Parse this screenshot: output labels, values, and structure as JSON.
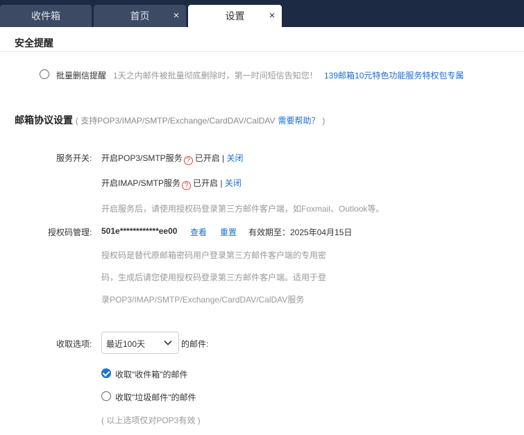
{
  "tabs": [
    {
      "label": "收件箱",
      "closable": false,
      "active": false
    },
    {
      "label": "首页",
      "closable": true,
      "active": false,
      "close": "×"
    },
    {
      "label": "设置",
      "closable": true,
      "active": true,
      "close": "×"
    }
  ],
  "security": {
    "title": "安全提醒",
    "option_label": "批量删信提醒",
    "option_desc": "1天之内邮件被批量彻底删除时，第一时间短信告知您！",
    "promo_link": "139邮箱10元特色功能服务特权包专属"
  },
  "protocol": {
    "title": "邮箱协议设置",
    "subtitle_prefix": "( 支持POP3/IMAP/SMTP/Exchange/CardDAV/CalDAV",
    "help_link": "需要帮助？",
    "subtitle_suffix": ")",
    "service_label": "服务开关:",
    "pop3_label": "开启POP3/SMTP服务",
    "pop3_status": "已开启 |",
    "pop3_close": "关闭",
    "imap_label": "开启IMAP/SMTP服务",
    "imap_status": "已开启 |",
    "imap_close": "关闭",
    "service_note": "开启服务后，请使用授权码登录第三方邮件客户端，如Foxmail、Outlook等。",
    "auth_label": "授权码管理:",
    "auth_code": "501e************ee00",
    "view_link": "查看",
    "reset_link": "重置",
    "expiry": "有效期至：2025年04月15日",
    "auth_note_1": "授权码是替代原邮箱密码用户登录第三方邮件客户端的专用密",
    "auth_note_2": "码，生成后请您使用授权码登录第三方邮件客户端。适用于登",
    "auth_note_3": "录POP3/IMAP/SMTP/Exchange/CardDAV/CalDAV服务",
    "receive_label": "收取选项:",
    "receive_select": "最近100天",
    "receive_suffix": "的邮件:",
    "inbox_option": "收取\"收件箱\"的邮件",
    "inbox_checked": true,
    "junk_option": "收取\"垃圾邮件\"的邮件",
    "junk_checked": false,
    "receive_note": "( 以上选项仅对POP3有效 )"
  },
  "colors": {
    "tabbar": "#1c2a44",
    "tab_inactive": "#3c4a63",
    "link": "#1a6fd0",
    "check": "#1a73d9",
    "help": "#e0443a"
  },
  "icons": {
    "help": "question-circle-icon",
    "select": "chevron-down-icon",
    "close": "close-icon"
  }
}
